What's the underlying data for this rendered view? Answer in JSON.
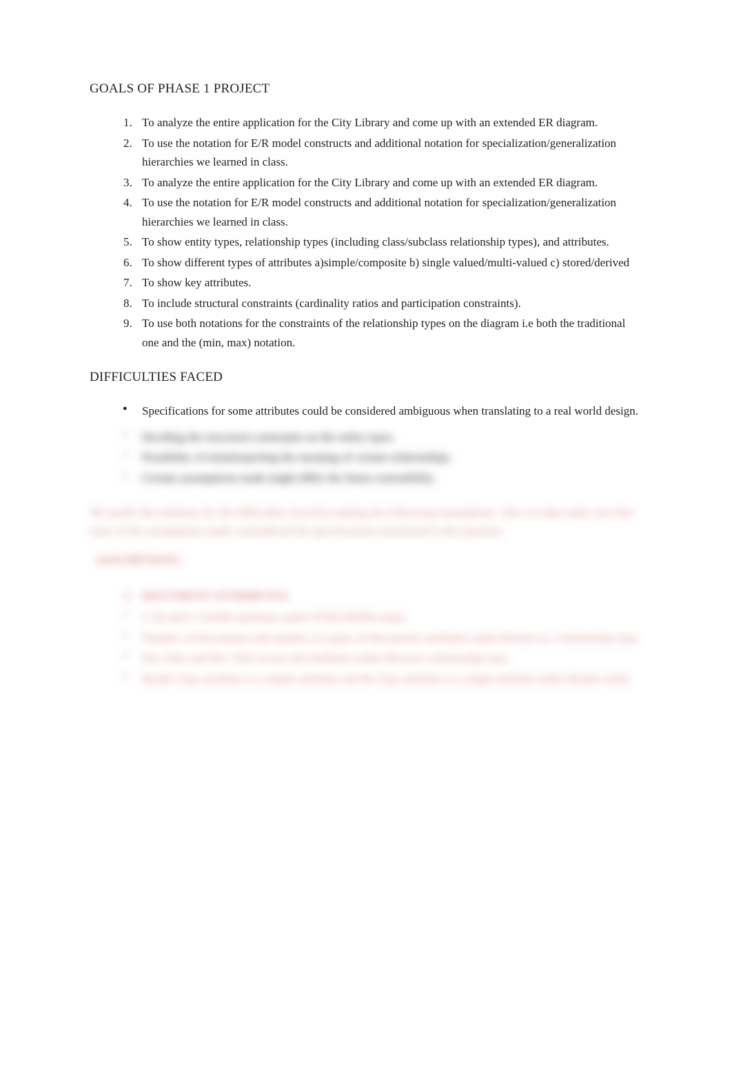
{
  "headings": {
    "goals": "GOALS OF PHASE 1 PROJECT",
    "difficulties": "DIFFICULTIES FACED",
    "assumptions": "ASSUMPTIONS"
  },
  "goals_list": [
    "To analyze the entire application for the City Library and come up with an extended ER diagram.",
    "To use the notation for E/R model constructs and additional notation for specialization/generalization hierarchies we learned in class.",
    "To analyze the entire application for the City Library and come up with an extended ER diagram.",
    "To use the notation for E/R model constructs and additional notation for specialization/generalization hierarchies we learned in class.",
    "To show entity types, relationship types (including class/subclass relationship types), and attributes.",
    "To show different types of attributes a)simple/composite b) single valued/multi-valued c) stored/derived",
    "To show key attributes.",
    "To include structural constraints (cardinality ratios and participation constraints).",
    "To use both notations for the constraints of the relationship types on the diagram i.e both the traditional one and the (min, max) notation."
  ],
  "difficulties_visible": [
    "Specifications for some attributes could be considered ambiguous when translating to a real world design."
  ],
  "difficulties_blurred": [
    "Deciding the structural constraints on the entity types.",
    "Possibility of misinterpreting the meaning of certain relationships.",
    "Certain assumptions made might differ the future extensibility."
  ],
  "blurred_paragraph": "We justify the solutions for the difficulties faced by making the following assumptions. Also we take make sure that none of the assumptions made contradicted the specifications mentioned in the question.",
  "blurred_section": {
    "title": "DOCUMENT ATTRIBUTES",
    "items": [
      "C ID and C NAME attributes under PUBLISHER entity.",
      "Number of Documents and number of copies of Documents attributes under Branch as a relationship type.",
      "Doc Date and Doc Title as text and attributes under Borrows relationship type.",
      "Reader Type attribute is a simple attribute and the Type attribute is a single attribute under Reader entity."
    ]
  }
}
